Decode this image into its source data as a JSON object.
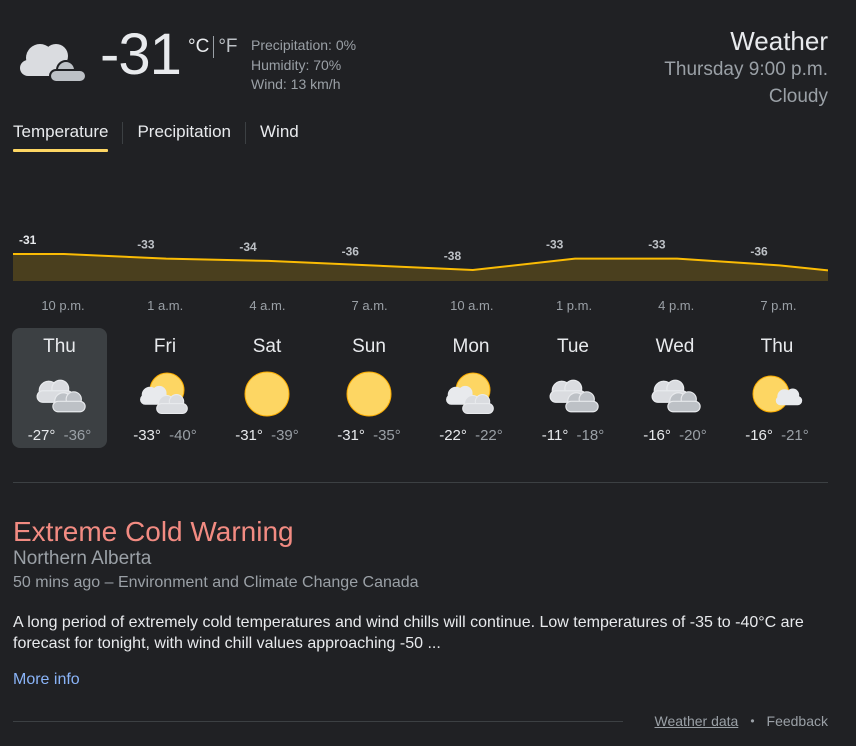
{
  "current": {
    "icon": "cloudy-icon",
    "temp": "-31",
    "unit_c": "°C",
    "unit_f": "°F",
    "precipitation": "Precipitation: 0%",
    "humidity": "Humidity: 70%",
    "wind": "Wind: 13 km/h"
  },
  "header": {
    "title": "Weather",
    "datetime": "Thursday 9:00 p.m.",
    "condition": "Cloudy"
  },
  "tabs": [
    {
      "label": "Temperature",
      "active": true
    },
    {
      "label": "Precipitation",
      "active": false
    },
    {
      "label": "Wind",
      "active": false
    }
  ],
  "chart_data": {
    "type": "area",
    "x": [
      "10 p.m.",
      "1 a.m.",
      "4 a.m.",
      "7 a.m.",
      "10 a.m.",
      "1 p.m.",
      "4 p.m.",
      "7 p.m."
    ],
    "series": [
      {
        "values": [
          -31,
          -33,
          -34,
          -36,
          -38,
          -33,
          -33,
          -36
        ]
      }
    ],
    "value_labels": [
      "-31",
      "-33",
      "-34",
      "-36",
      "-38",
      "-33",
      "-33",
      "-36"
    ],
    "line_color": "#fbbc04",
    "fill_color": "#4a3f1e",
    "grid": false,
    "legend": "none"
  },
  "forecast": [
    {
      "day": "Thu",
      "icon": "cloudy-icon",
      "hi": "-27°",
      "lo": "-36°",
      "active": true
    },
    {
      "day": "Fri",
      "icon": "partly-cloudy-icon",
      "hi": "-33°",
      "lo": "-40°",
      "active": false
    },
    {
      "day": "Sat",
      "icon": "sunny-icon",
      "hi": "-31°",
      "lo": "-39°",
      "active": false
    },
    {
      "day": "Sun",
      "icon": "sunny-icon",
      "hi": "-31°",
      "lo": "-35°",
      "active": false
    },
    {
      "day": "Mon",
      "icon": "partly-cloudy-icon",
      "hi": "-22°",
      "lo": "-22°",
      "active": false
    },
    {
      "day": "Tue",
      "icon": "cloudy-icon",
      "hi": "-11°",
      "lo": "-18°",
      "active": false
    },
    {
      "day": "Wed",
      "icon": "cloudy-icon",
      "hi": "-16°",
      "lo": "-20°",
      "active": false
    },
    {
      "day": "Thu",
      "icon": "mostly-sunny-icon",
      "hi": "-16°",
      "lo": "-21°",
      "active": false
    }
  ],
  "alert": {
    "title": "Extreme Cold Warning",
    "region": "Northern Alberta",
    "source": "50 mins ago – Environment and Climate Change Canada",
    "body": "A long period of extremely cold temperatures and wind chills will continue. Low temperatures of -35 to -40°C are forecast for tonight, with wind chill values approaching -50 ...",
    "more_info": "More info"
  },
  "footer": {
    "weather_data": "Weather data",
    "separator": "•",
    "feedback": "Feedback"
  },
  "colors": {
    "background": "#202124",
    "accent": "#fdd663",
    "alert": "#f28b82",
    "link": "#8ab4f8"
  }
}
